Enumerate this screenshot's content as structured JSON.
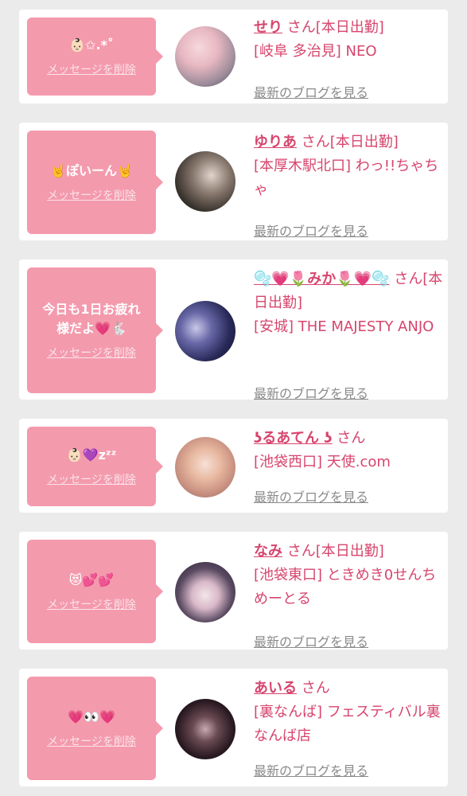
{
  "delete_label": "メッセージを削除",
  "blog_label": "最新のブログを見る",
  "san": "さん",
  "colors": {
    "accent": "#d7456e",
    "bubble": "#f49aad",
    "background": "#ecebec"
  },
  "cards": [
    {
      "message": "👶🏻✩.*˚",
      "name": "せり",
      "status": "[本日出勤]",
      "store": "[岐阜 多治見] NEO"
    },
    {
      "message": "🤘ぽいーん🤘",
      "name": "ゆりあ",
      "status": "[本日出勤]",
      "store": "[本厚木駅北口] わっ!!ちゃちゃ"
    },
    {
      "message": "今日も1日お疲れ様だよ💗🐇",
      "name": "🫧💗🌷みか🌷💗🫧",
      "status": "[本日出勤]",
      "store": "[安城] THE MAJESTY ANJO"
    },
    {
      "message": "👶🏻💜zᶻᶻ",
      "name": "ʖるあてん ʖ",
      "status": "",
      "store": "[池袋西口] 天使.com"
    },
    {
      "message": "😻💕💕",
      "name": "なみ",
      "status": "[本日出勤]",
      "store": "[池袋東口] ときめき0せんちめーとる"
    },
    {
      "message": "💗👀💗",
      "name": "あいる",
      "status": "",
      "store": "[裏なんば] フェスティバル裏なんば店"
    }
  ]
}
